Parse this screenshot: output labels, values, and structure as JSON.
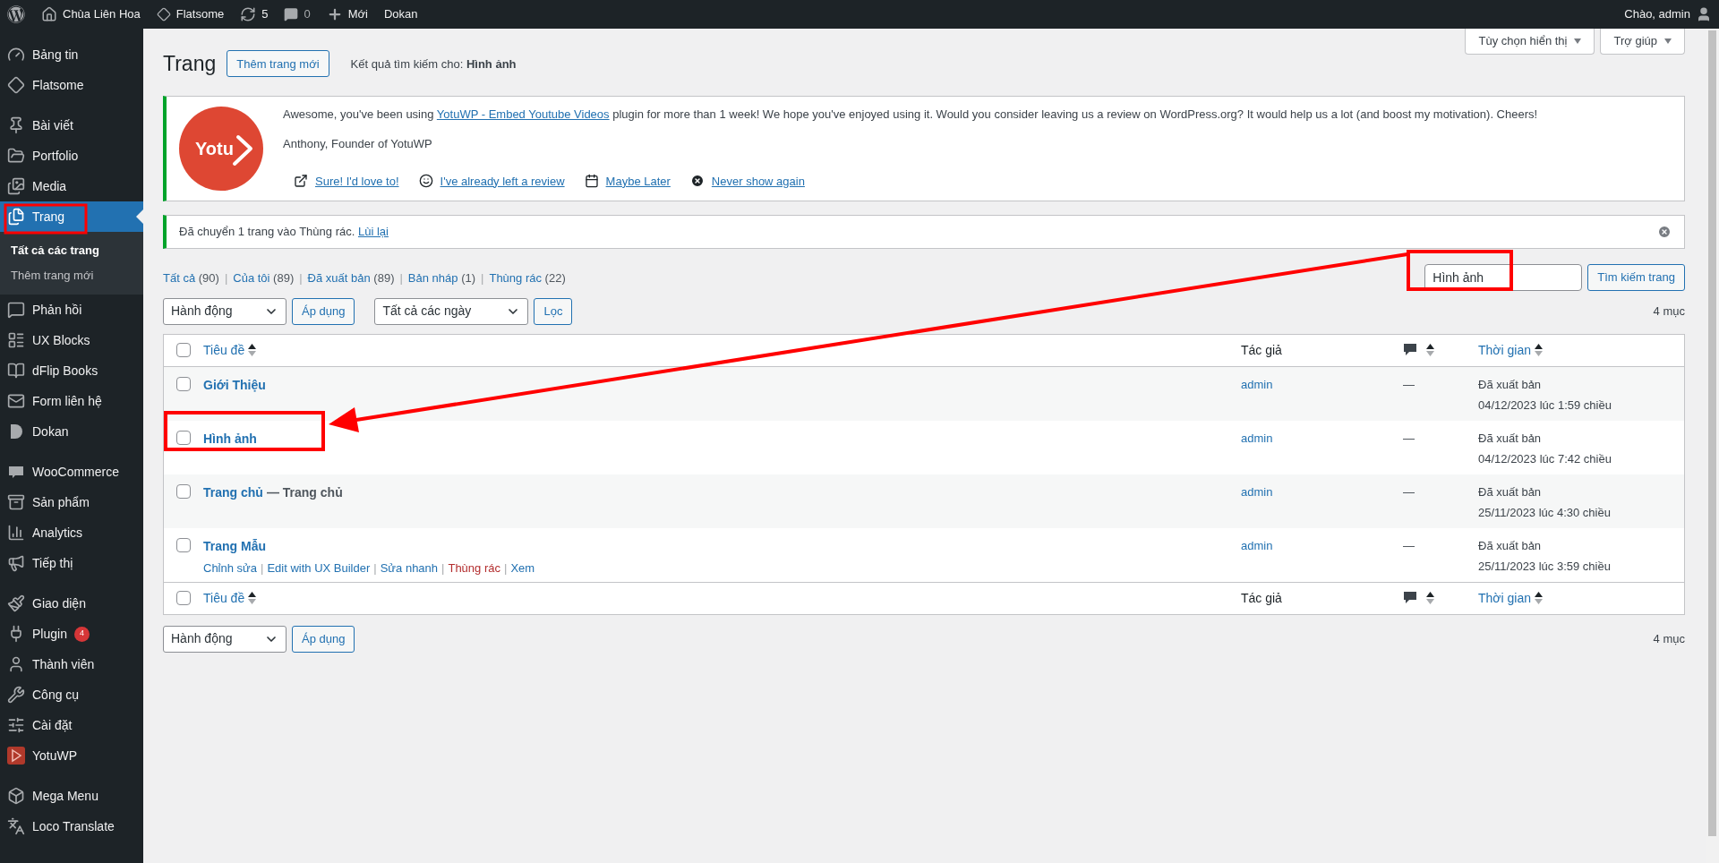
{
  "admin_bar": {
    "site": "Chùa Liên Hoa",
    "theme": "Flatsome",
    "updates": "5",
    "comments": "0",
    "new": "Mới",
    "plugin": "Dokan",
    "greeting": "Chào, admin"
  },
  "sidebar": {
    "groups": [
      [
        {
          "label": "Bảng tin",
          "selected": false
        },
        {
          "label": "Flatsome",
          "selected": false
        }
      ],
      [
        {
          "label": "Bài viết",
          "selected": false
        },
        {
          "label": "Portfolio",
          "selected": false
        },
        {
          "label": "Media",
          "selected": false
        },
        {
          "label": "Trang",
          "selected": true,
          "children": [
            {
              "label": "Tất cả các trang",
              "selected": true
            },
            {
              "label": "Thêm trang mới",
              "selected": false
            }
          ]
        },
        {
          "label": "Phản hồi",
          "selected": false
        },
        {
          "label": "UX Blocks",
          "selected": false
        },
        {
          "label": "dFlip Books",
          "selected": false
        },
        {
          "label": "Form liên hệ",
          "selected": false
        },
        {
          "label": "Dokan",
          "selected": false
        }
      ],
      [
        {
          "label": "WooCommerce",
          "selected": false
        },
        {
          "label": "Sản phẩm",
          "selected": false
        },
        {
          "label": "Analytics",
          "selected": false
        },
        {
          "label": "Tiếp thị",
          "selected": false
        }
      ],
      [
        {
          "label": "Giao diện",
          "selected": false
        },
        {
          "label": "Plugin",
          "selected": false,
          "badge": "4"
        },
        {
          "label": "Thành viên",
          "selected": false
        },
        {
          "label": "Công cụ",
          "selected": false
        },
        {
          "label": "Cài đặt",
          "selected": false
        },
        {
          "label": "YotuWP",
          "selected": false
        }
      ],
      [
        {
          "label": "Mega Menu",
          "selected": false
        },
        {
          "label": "Loco Translate",
          "selected": false
        }
      ]
    ]
  },
  "screen_tabs": [
    "Tùy chọn hiển thị",
    "Trợ giúp"
  ],
  "page_title": "Trang",
  "add_button": "Thêm trang mới",
  "search_result": "Kết quả tìm kiếm cho: **Hình ảnh**",
  "review_notice": {
    "logo_text": "Yotu",
    "before": "Awesome, you've been using ",
    "link": "YotuWP - Embed Youtube Videos",
    "after": " plugin for more than 1 week! We hope you've enjoyed using it. Would you consider leaving us a review on WordPress.org? It would help us a lot (and boost my motivation). Cheers!",
    "signature": "Anthony, Founder of YotuWP",
    "actions": [
      {
        "kind": "external",
        "label": "Sure! I'd love to!"
      },
      {
        "kind": "smile",
        "label": "I've already left a review"
      },
      {
        "kind": "calendar",
        "label": "Maybe Later"
      },
      {
        "kind": "close",
        "label": "Never show again"
      }
    ]
  },
  "trash_notice": {
    "text": "Đã chuyển 1 trang vào Thùng rác.",
    "link": "Lùi lại"
  },
  "views": {
    "separator": "|",
    "items": [
      {
        "label": "Tất cả",
        "count": "(90)"
      },
      {
        "label": "Của tôi",
        "count": "(89)"
      },
      {
        "label": "Đã xuất bản",
        "count": "(89)"
      },
      {
        "label": "Bản nháp",
        "count": "(1)"
      },
      {
        "label": "Thùng rác",
        "count": "(22)"
      }
    ]
  },
  "search": {
    "value": "Hình ảnh",
    "button": "Tìm kiếm trang"
  },
  "top_actions": {
    "bulk": "Hành động",
    "apply": "Áp dụng",
    "dates": "Tất cả các ngày",
    "filter": "Lọc",
    "count": "4 mục"
  },
  "table": {
    "select_all_checked": false,
    "footer_select_all_checked": false,
    "columns": [
      {
        "kind": "title",
        "label": "Tiêu đề",
        "sortable": true
      },
      {
        "kind": "author",
        "label": "Tác giả",
        "sortable": false
      },
      {
        "kind": "comments",
        "sortable": true
      },
      {
        "kind": "date",
        "label": "Thời gian",
        "sortable": true
      }
    ],
    "rows": [
      {
        "checked": false,
        "title": "Giới Thiệu",
        "author": "admin",
        "comments": "—",
        "status": "Đã xuất bản",
        "date": "04/12/2023 lúc 1:59 chiều"
      },
      {
        "checked": false,
        "title": "Hình ảnh",
        "author": "admin",
        "comments": "—",
        "status": "Đã xuất bản",
        "date": "04/12/2023 lúc 7:42 chiều"
      },
      {
        "checked": false,
        "title": "Trang chủ",
        "state": "— Trang chủ",
        "author": "admin",
        "comments": "—",
        "status": "Đã xuất bản",
        "date": "25/11/2023 lúc 4:30 chiều"
      },
      {
        "checked": false,
        "title": "Trang Mẫu",
        "author": "admin",
        "comments": "—",
        "status": "Đã xuất bản",
        "date": "25/11/2023 lúc 3:59 chiều",
        "actions_separator": "|",
        "actions": [
          {
            "label": "Chỉnh sửa",
            "kind": "link"
          },
          {
            "label": "Edit with UX Builder",
            "kind": "link"
          },
          {
            "label": "Sửa nhanh",
            "kind": "link"
          },
          {
            "label": "Thùng rác",
            "kind": "delete"
          },
          {
            "label": "Xem",
            "kind": "link"
          }
        ]
      }
    ],
    "footer_columns": [
      {
        "kind": "title",
        "label": "Tiêu đề",
        "sortable": true
      },
      {
        "kind": "author",
        "label": "Tác giả",
        "sortable": false
      },
      {
        "kind": "comments",
        "sortable": true
      },
      {
        "kind": "date",
        "label": "Thời gian",
        "sortable": true
      }
    ]
  },
  "bottom_actions": {
    "bulk": "Hành động",
    "apply": "Áp dụng",
    "count": "4 mục"
  }
}
